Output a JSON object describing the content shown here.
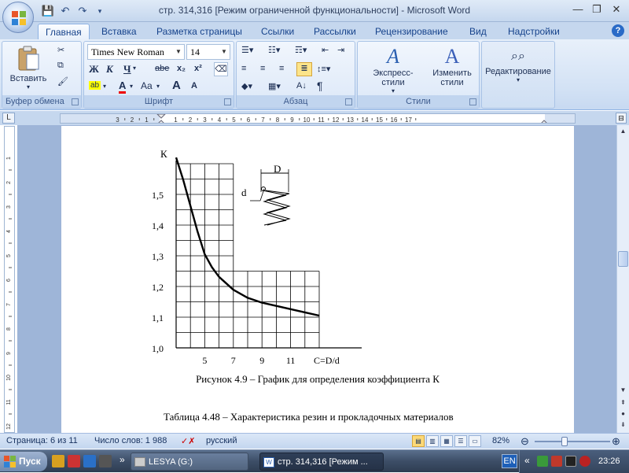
{
  "window": {
    "title": "стр. 314,316 [Режим ограниченной функциональности] - Microsoft Word"
  },
  "tabs": [
    "Главная",
    "Вставка",
    "Разметка страницы",
    "Ссылки",
    "Рассылки",
    "Рецензирование",
    "Вид",
    "Надстройки"
  ],
  "ribbon": {
    "clipboard": {
      "label": "Буфер обмена",
      "paste": "Вставить"
    },
    "font": {
      "label": "Шрифт",
      "name": "Times New Roman",
      "size": "14",
      "bold": "Ж",
      "italic": "К",
      "underline": "Ч",
      "strike": "abe",
      "sub": "x₂",
      "sup": "x²",
      "grow": "A",
      "shrink": "A",
      "change_case": "Aa"
    },
    "paragraph": {
      "label": "Абзац",
      "pilcrow": "¶"
    },
    "styles": {
      "label": "Стили",
      "express": "Экспресс-стили",
      "change": "Изменить стили"
    },
    "editing": {
      "label": "Редактирование"
    }
  },
  "ruler": {
    "numbers": [
      "3",
      "2",
      "1",
      "1",
      "2",
      "3",
      "4",
      "5",
      "6",
      "7",
      "8",
      "9",
      "10",
      "11",
      "12",
      "13",
      "14",
      "15",
      "16",
      "17"
    ],
    "v_numbers": [
      "1",
      "2",
      "3",
      "4",
      "5",
      "6",
      "7",
      "8",
      "9",
      "10",
      "11",
      "12"
    ]
  },
  "document": {
    "caption": "Рисунок 4.9 – График для определения коэффициента К",
    "table_caption_partial": "Таблица  4.48  –  Характеристика  резин  и  прокладочных  материалов"
  },
  "chart_data": {
    "type": "line",
    "title": "",
    "ylabel": "К",
    "xlabel": "C=D/d",
    "y_ticks": [
      "1,0",
      "1,1",
      "1,2",
      "1,3",
      "1,4",
      "1,5"
    ],
    "x_ticks": [
      "5",
      "7",
      "9",
      "11"
    ],
    "xlim": [
      3,
      13
    ],
    "ylim": [
      1.0,
      1.6
    ],
    "grid": true,
    "series": [
      {
        "x": [
          3,
          3.5,
          4,
          4.5,
          5,
          5.5,
          6,
          7,
          8,
          9,
          10,
          11,
          12,
          13
        ],
        "y": [
          1.59,
          1.52,
          1.44,
          1.36,
          1.29,
          1.25,
          1.22,
          1.18,
          1.155,
          1.14,
          1.13,
          1.12,
          1.11,
          1.1
        ]
      }
    ],
    "inset_labels": {
      "D": "D",
      "d": "d"
    }
  },
  "status": {
    "page": "Страница: 6 из 11",
    "words": "Число слов: 1 988",
    "language": "русский",
    "zoom": "82%"
  },
  "taskbar": {
    "start": "Пуск",
    "task1": "LESYA (G:)",
    "task2": "стр. 314,316 [Режим ...",
    "lang": "EN",
    "time": "23:26"
  }
}
